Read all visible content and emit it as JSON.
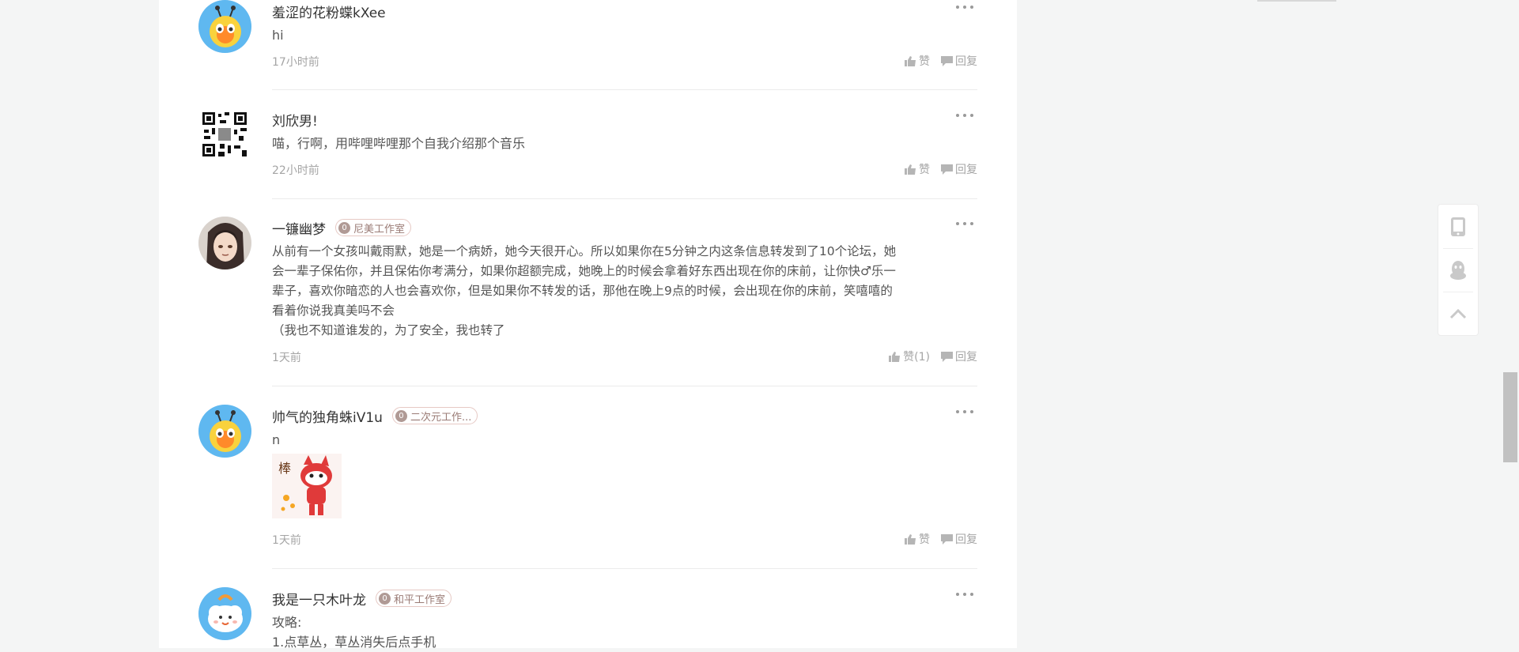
{
  "comments": [
    {
      "username": "羞涩的花粉蝶kXee",
      "avatar": "bee-mascot-avatar",
      "text": "hi",
      "time": "17小时前",
      "like_label": "赞",
      "reply_label": "回复"
    },
    {
      "username": "刘欣男!",
      "avatar": "qr-code-avatar",
      "text": "喵，行啊，用哔哩哔哩那个自我介绍那个音乐",
      "time": "22小时前",
      "like_label": "赞",
      "reply_label": "回复"
    },
    {
      "username": "一镰幽梦",
      "avatar": "anime-character-avatar",
      "badge_level": "0",
      "badge_text": "尼美工作室",
      "text": "从前有一个女孩叫戴雨默，她是一个病娇，她今天很开心。所以如果你在5分钟之内这条信息转发到了10个论坛，她\n会一辈子保佑你，并且保佑你考满分，如果你超额完成，她晚上的时候会拿着好东西出现在你的床前，让你快♂乐一\n辈子，喜欢你暗恋的人也会喜欢你，但是如果你不转发的话，那他在晚上9点的时候，会出现在你的床前，笑嘻嘻的\n看着你说我真美吗不会\n（我也不知道谁发的，为了安全，我也转了",
      "time": "1天前",
      "like_label": "赞(1)",
      "reply_label": "回复"
    },
    {
      "username": "帅气的独角蛛iV1u",
      "avatar": "bee-mascot-avatar",
      "badge_level": "0",
      "badge_text": "二次元工作...",
      "text": "n",
      "sticker": "cat-sticker-bang",
      "sticker_text": "棒",
      "time": "1天前",
      "like_label": "赞",
      "reply_label": "回复"
    },
    {
      "username": "我是一只木叶龙",
      "avatar": "cloud-mascot-avatar",
      "badge_level": "0",
      "badge_text": "和平工作室",
      "text": "攻略:\n1.点草丛，草丛消失后点手机"
    }
  ],
  "side_tools": [
    "phone-icon",
    "qq-penguin-icon",
    "back-to-top-icon"
  ],
  "colors": {
    "badge_border": "#e6c9c4",
    "badge_text": "#9a7b75",
    "meta": "#a5a5a5",
    "page_bg": "#f4f5f5"
  }
}
